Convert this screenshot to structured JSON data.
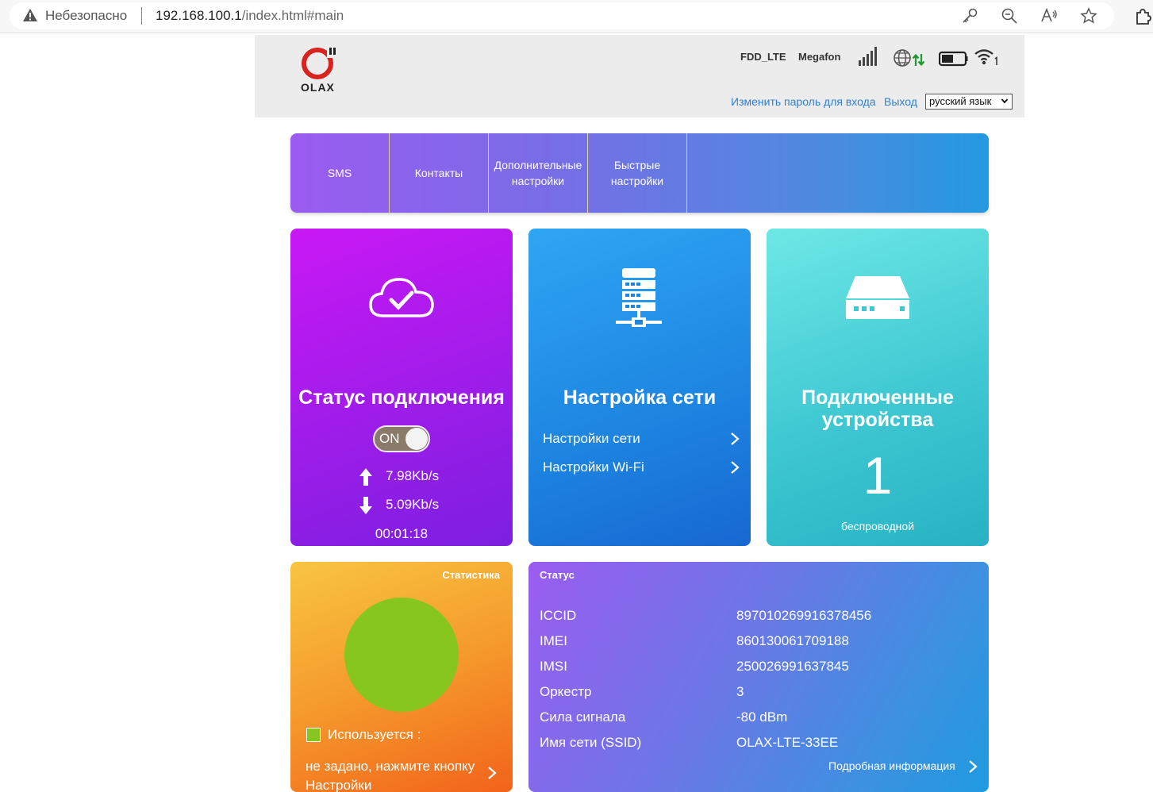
{
  "browser": {
    "security_label": "Небезопасно",
    "url_host": "192.168.100.1",
    "url_path": "/index.html#main"
  },
  "header": {
    "logo_text": "OLAX",
    "network_type": "FDD_LTE",
    "operator": "Megafon",
    "change_password": "Изменить пароль для входа",
    "logout": "Выход",
    "language": "русский язык"
  },
  "nav": [
    {
      "label": "SMS"
    },
    {
      "label": "Контакты"
    },
    {
      "label": "Дополнительные настройки"
    },
    {
      "label": "Быстрые настройки"
    }
  ],
  "status_card": {
    "title": "Статус подключения",
    "toggle": "ON",
    "upload": "7.98Kb/s",
    "download": "5.09Kb/s",
    "duration": "00:01:18"
  },
  "network_card": {
    "title": "Настройка сети",
    "links": [
      {
        "label": "Настройки сети"
      },
      {
        "label": "Настройки Wi-Fi"
      }
    ]
  },
  "devices_card": {
    "title": "Подключенные устройства",
    "count": "1",
    "type": "беспроводной"
  },
  "stats_card": {
    "title": "Статистика",
    "legend_label": "Используется :",
    "note": "не задано, нажмите кнопку Настройки",
    "pie_color": "#86c61e"
  },
  "info_card": {
    "title": "Статус",
    "rows": [
      {
        "key": "ICCID",
        "value": "897010269916378456"
      },
      {
        "key": "IMEI",
        "value": "860130061709188"
      },
      {
        "key": "IMSI",
        "value": "250026991637845"
      },
      {
        "key": "Оркестр",
        "value": "3"
      },
      {
        "key": "Сила сигнала",
        "value": "-80 dBm"
      },
      {
        "key": "Имя сети (SSID)",
        "value": "OLAX-LTE-33EE"
      }
    ],
    "more_link": "Подробная информация"
  }
}
